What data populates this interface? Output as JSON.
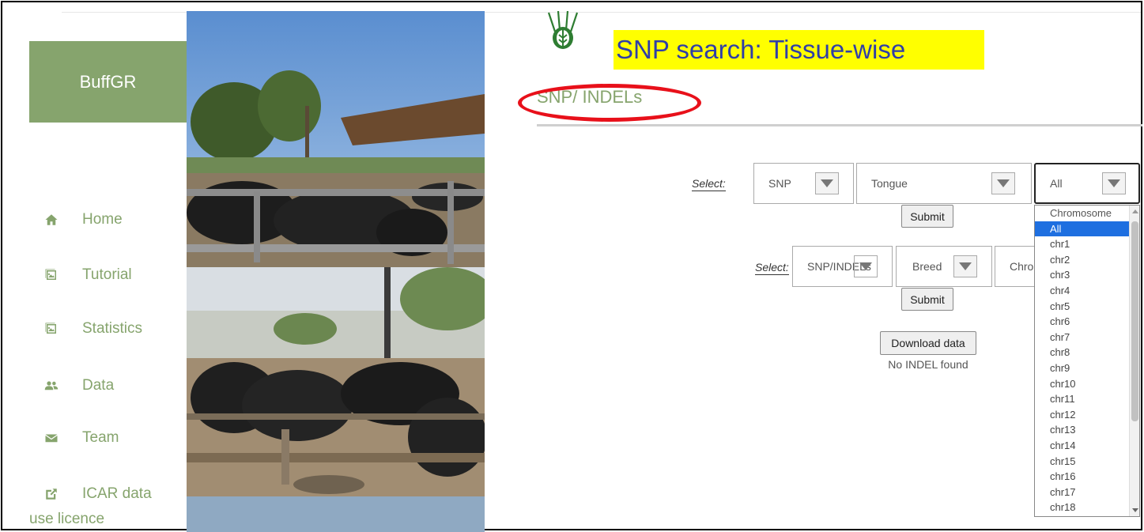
{
  "sidebar": {
    "brand": "BuffGR",
    "items": [
      {
        "label": "Home",
        "icon": "home-icon"
      },
      {
        "label": "Tutorial",
        "icon": "image-icon"
      },
      {
        "label": "Statistics",
        "icon": "image-icon"
      },
      {
        "label": "Data",
        "icon": "users-icon"
      },
      {
        "label": "Team",
        "icon": "envelope-icon"
      },
      {
        "label": "ICAR data",
        "icon": "external-link-icon"
      }
    ],
    "licence_tail": "use licence"
  },
  "header": {
    "highlight_title": "SNP search: Tissue-wise",
    "section_title": "SNP/ INDELs",
    "logo": "ICAR"
  },
  "form1": {
    "label": "Select:",
    "type_value": "SNP",
    "tissue_value": "Tongue",
    "chromosome_value": "All",
    "submit": "Submit"
  },
  "form2": {
    "label": "Select:",
    "type_value": "SNP/INDELs",
    "breed_value": "Breed",
    "chromosome_value": "Chro",
    "submit": "Submit"
  },
  "download": {
    "button": "Download data",
    "status": "No INDEL found"
  },
  "dropdown": {
    "options": [
      "Chromosome",
      "All",
      "chr1",
      "chr2",
      "chr3",
      "chr4",
      "chr5",
      "chr6",
      "chr7",
      "chr8",
      "chr9",
      "chr10",
      "chr11",
      "chr12",
      "chr13",
      "chr14",
      "chr15",
      "chr16",
      "chr17",
      "chr18"
    ],
    "selected": "All"
  },
  "colors": {
    "brand_green": "#86a46d",
    "highlight": "#ffff00",
    "title_blue": "#2f3ea8",
    "annotation_red": "#e8101a",
    "selection_blue": "#1e6fe0"
  }
}
